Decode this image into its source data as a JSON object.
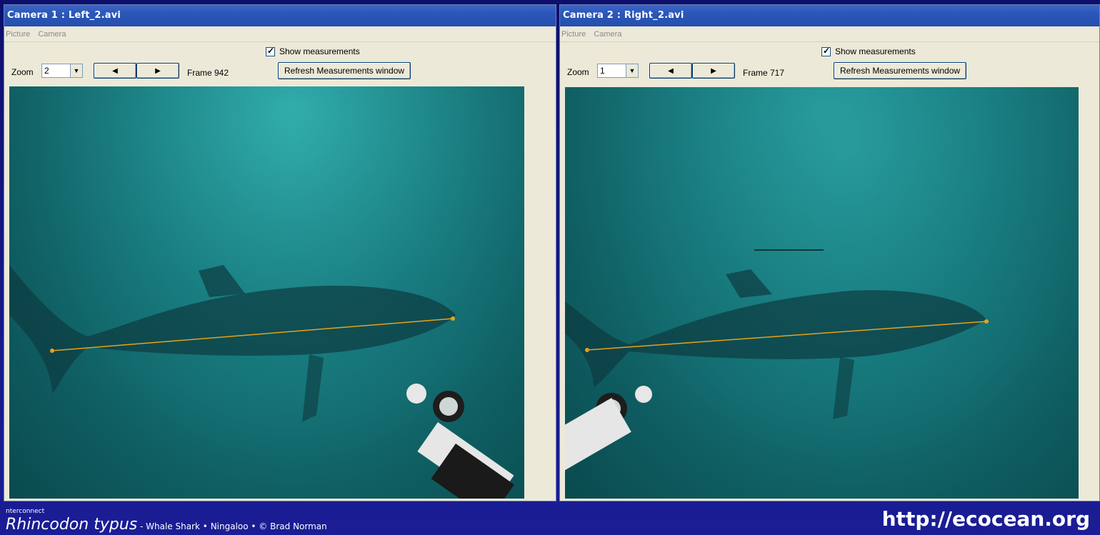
{
  "camera1": {
    "title": "Camera 1 : Left_2.avi",
    "menu": [
      "Picture",
      "Camera"
    ],
    "show_measurements_label": "Show measurements",
    "show_measurements_checked": true,
    "zoom_label": "Zoom",
    "zoom_value": "2",
    "prev_icon": "triangle-left-icon",
    "next_icon": "triangle-right-icon",
    "frame_label": "Frame 942",
    "refresh_label": "Refresh Measurements window"
  },
  "camera2": {
    "title": "Camera 2 : Right_2.avi",
    "menu": [
      "Picture",
      "Camera"
    ],
    "show_measurements_label": "Show measurements",
    "show_measurements_checked": true,
    "zoom_label": "Zoom",
    "zoom_value": "1",
    "prev_icon": "triangle-left-icon",
    "next_icon": "triangle-right-icon",
    "frame_label": "Frame 717",
    "refresh_label": "Refresh Measurements window"
  },
  "footer": {
    "small_text": "nterconnect",
    "caption_main": "Rhincodon typus",
    "caption_sub": " - Whale Shark • Ningaloo • © Brad Norman",
    "url": "http://ecocean.org"
  },
  "colors": {
    "measurement_line": "#e7a21a",
    "titlebar": "#2c56b8",
    "background": "#12157a"
  }
}
